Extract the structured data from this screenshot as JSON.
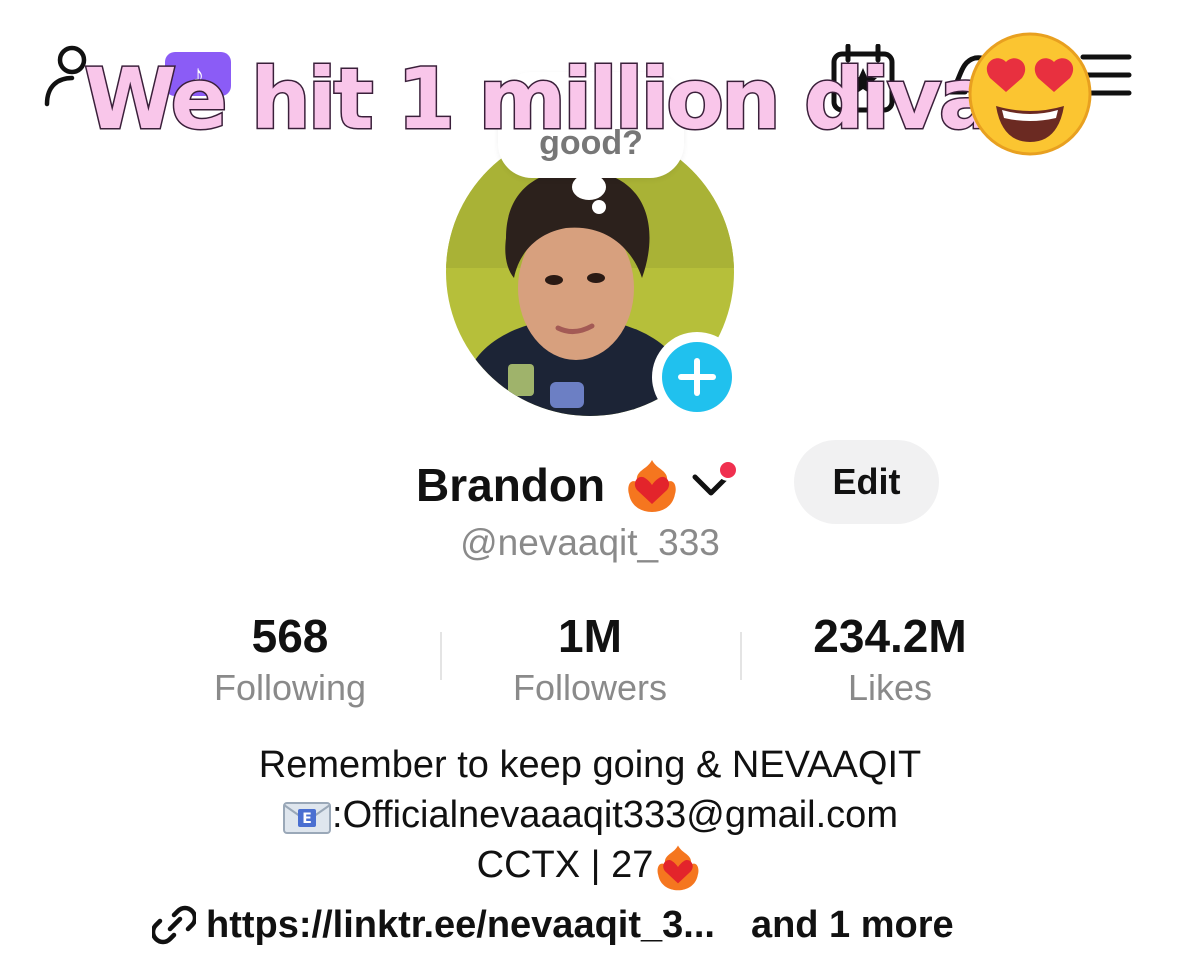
{
  "top_bar": {
    "add_user_icon": "add-user-icon",
    "tiktok_badge_icon": "tiktok-note-icon",
    "calendar_icon": "calendar-star-icon",
    "bell_icon": "notification-icon",
    "menu_icon": "hamburger-menu-icon"
  },
  "overlay": {
    "title": "We hit 1 million divas",
    "emoji": "heart-eyes-emoji"
  },
  "avatar": {
    "bubble_text": "good?",
    "add_photo_icon": "plus-icon"
  },
  "profile": {
    "display_name": "Brandon",
    "name_emoji": "heart-on-fire-emoji",
    "username": "@nevaaqit_333",
    "edit_label": "Edit"
  },
  "stats": [
    {
      "value": "568",
      "label": "Following"
    },
    {
      "value": "1M",
      "label": "Followers"
    },
    {
      "value": "234.2M",
      "label": "Likes"
    }
  ],
  "bio": {
    "line1": "Remember to keep going & NEVAAQIT",
    "line2": ":Officialnevaaaqit333@gmail.com",
    "line2_icon": "email-envelope-emoji",
    "line3": "CCTX | 27",
    "line3_icon": "heart-on-fire-emoji"
  },
  "link": {
    "url": "https://linktr.ee/nevaaqit_3...",
    "more": "and 1 more",
    "icon": "link-icon"
  },
  "colors": {
    "accent_blue": "#20c1ee",
    "notif_red": "#f0304f",
    "overlay_pink": "#f9c6ea",
    "badge_purple": "#8b5cf6"
  }
}
